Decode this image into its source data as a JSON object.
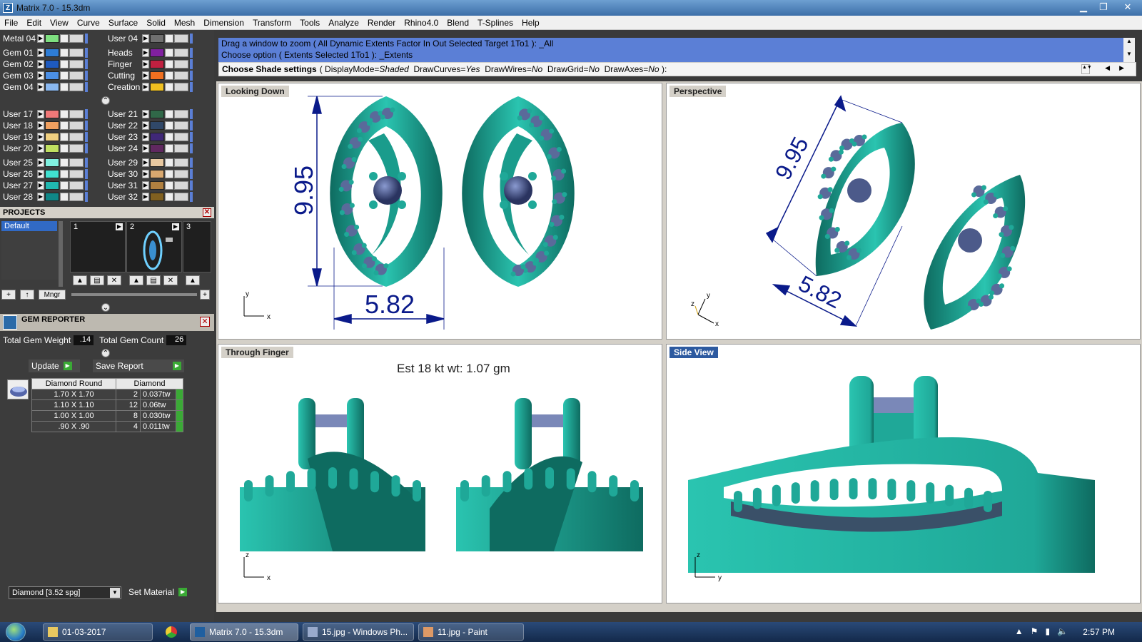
{
  "window": {
    "title": "Matrix 7.0 - 15.3dm",
    "icon": "Z"
  },
  "menu": [
    "File",
    "Edit",
    "View",
    "Curve",
    "Surface",
    "Solid",
    "Mesh",
    "Dimension",
    "Transform",
    "Tools",
    "Analyze",
    "Render",
    "Rhino4.0",
    "Blend",
    "T-Splines",
    "Help"
  ],
  "layers": {
    "col1": [
      {
        "name": "Metal 04",
        "color": "#7ee080"
      },
      {
        "name": "Gem 01",
        "color": "#2e7dd6"
      },
      {
        "name": "Gem 02",
        "color": "#1e5ac0"
      },
      {
        "name": "Gem 03",
        "color": "#4b8fe6"
      },
      {
        "name": "Gem 04",
        "color": "#8ab8f0"
      },
      {
        "name": "User 17",
        "color": "#f07878"
      },
      {
        "name": "User 18",
        "color": "#f0a060"
      },
      {
        "name": "User 19",
        "color": "#f0d080"
      },
      {
        "name": "User 20",
        "color": "#c0e060"
      },
      {
        "name": "User 25",
        "color": "#80f0e0"
      },
      {
        "name": "User 26",
        "color": "#40e0d0"
      },
      {
        "name": "User 27",
        "color": "#20b8b0"
      },
      {
        "name": "User 28",
        "color": "#108888"
      }
    ],
    "col2": [
      {
        "name": "User 04",
        "color": "#707070"
      },
      {
        "name": "Heads",
        "color": "#8020a0"
      },
      {
        "name": "Finger",
        "color": "#c02040"
      },
      {
        "name": "Cutting",
        "color": "#f07020"
      },
      {
        "name": "Creation",
        "color": "#f0c020"
      },
      {
        "name": "User 21",
        "color": "#306848"
      },
      {
        "name": "User 22",
        "color": "#304868"
      },
      {
        "name": "User 23",
        "color": "#402878"
      },
      {
        "name": "User 24",
        "color": "#602860"
      },
      {
        "name": "User 29",
        "color": "#e8c8a0"
      },
      {
        "name": "User 30",
        "color": "#d8a870"
      },
      {
        "name": "User 31",
        "color": "#b08040"
      },
      {
        "name": "User 32",
        "color": "#806020"
      }
    ]
  },
  "projects": {
    "header": "PROJECTS",
    "selected": "Default",
    "thumbs": [
      "1",
      "2",
      "3"
    ],
    "mngr_label": "Mngr"
  },
  "gem_reporter": {
    "header": "GEM REPORTER",
    "total_weight_label": "Total Gem Weight",
    "total_weight": ".14",
    "total_count_label": "Total Gem Count",
    "total_count": "26",
    "update_label": "Update",
    "save_label": "Save Report",
    "table_headers": [
      "Diamond Round",
      "Diamond"
    ],
    "rows": [
      {
        "size": "1.70 X 1.70",
        "count": "2",
        "weight": "0.037tw"
      },
      {
        "size": "1.10 X 1.10",
        "count": "12",
        "weight": "0.06tw"
      },
      {
        "size": "1.00 X 1.00",
        "count": "8",
        "weight": "0.030tw"
      },
      {
        "size": ".90 X .90",
        "count": "4",
        "weight": "0.011tw"
      }
    ],
    "material": "Diamond    [3.52 spg]",
    "set_material_label": "Set Material"
  },
  "command": {
    "history": [
      "Drag a window to zoom ( All  Dynamic  Extents  Factor  In  Out  Selected  Target  1To1 ): _All",
      "Choose option ( Extents  Selected  1To1 ): _Extents"
    ],
    "prompt_bold": "Choose Shade settings",
    "prompt_open": "(",
    "opt_display_label": "DisplayMode=",
    "opt_display_value": "Shaded",
    "opt_curves_label": "DrawCurves=",
    "opt_curves_value": "Yes",
    "opt_wires_label": "DrawWires=",
    "opt_wires_value": "No",
    "opt_grid_label": "DrawGrid=",
    "opt_grid_value": "No",
    "opt_axes_label": "DrawAxes=",
    "opt_axes_value": "No",
    "prompt_close": "):"
  },
  "viewports": {
    "top": {
      "title": "Looking Down",
      "dim_height": "9.95",
      "dim_width": "5.82"
    },
    "persp": {
      "title": "Perspective",
      "dim_height": "9.95",
      "dim_width": "5.82"
    },
    "front": {
      "title": "Through Finger",
      "weight_text": "Est 18 kt wt: 1.07 gm"
    },
    "side": {
      "title": "Side View"
    }
  },
  "axes": {
    "x": "x",
    "y": "y",
    "z": "z"
  },
  "colors": {
    "metal": "#1fa898",
    "metal_dark": "#0e6b60",
    "gem": "#5a6a9a",
    "dim": "#0a1a8a",
    "accent": "#5b7fd6"
  },
  "taskbar": {
    "items": [
      "01-03-2017",
      "Matrix 7.0 - 15.3dm",
      "15.jpg - Windows Ph...",
      "11.jpg - Paint"
    ],
    "clock": "2:57 PM"
  }
}
